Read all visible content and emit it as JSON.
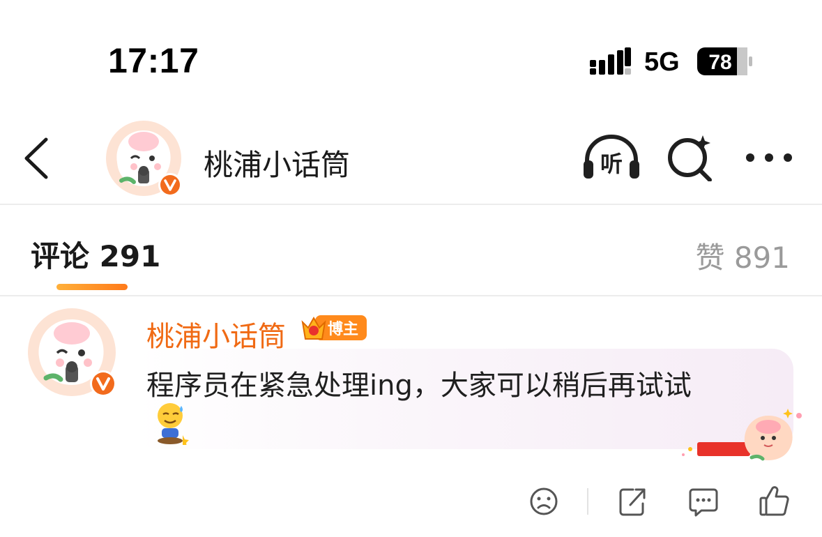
{
  "status_bar": {
    "time": "17:17",
    "network": "5G",
    "battery": "78"
  },
  "header": {
    "back_icon": "chevron-left-icon",
    "account_name": "桃浦小话筒",
    "listen_label": "听",
    "search_icon": "ai-search-icon",
    "more_icon": "more-dots-icon"
  },
  "tabs": {
    "comments_label": "评论 291",
    "likes_label": "赞 891"
  },
  "comment": {
    "author": "桃浦小话筒",
    "author_badge": "博主",
    "text": "程序员在紧急处理ing，大家可以稍后再试试",
    "emoji": "sweat-smile-emoji",
    "actions": [
      "dislike-icon",
      "share-icon",
      "comment-icon",
      "like-icon"
    ]
  },
  "colors": {
    "accent": "#f06a14",
    "verified": "#f26b1d",
    "gradient_start": "#ffb03a",
    "gradient_end": "#ff7a1a"
  }
}
